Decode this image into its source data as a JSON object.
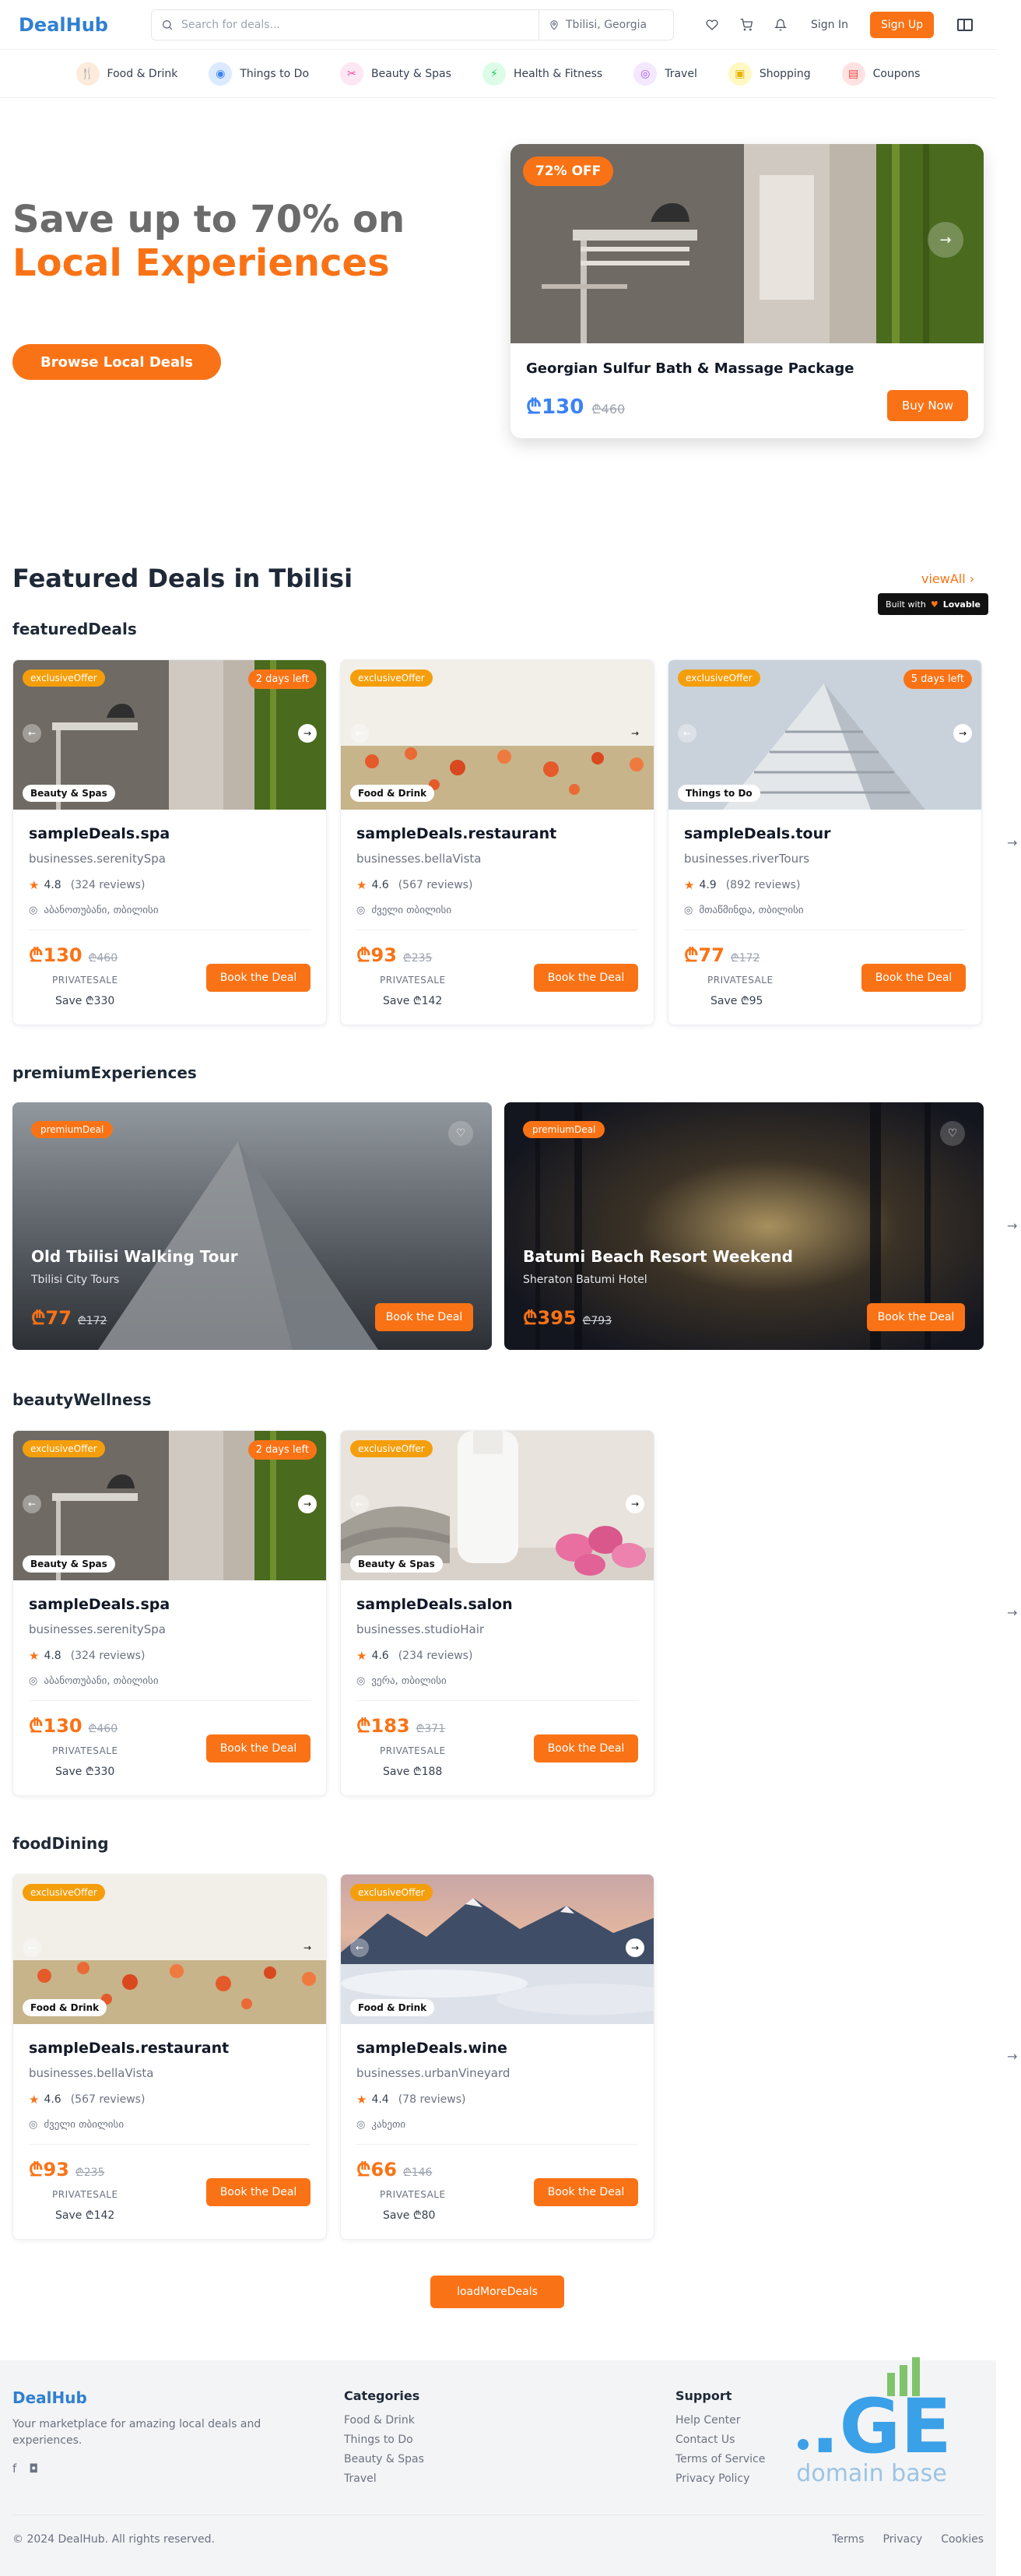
{
  "header": {
    "logo": "DealHub",
    "search_placeholder": "Search for deals...",
    "location": "Tbilisi, Georgia",
    "sign_in": "Sign In",
    "sign_up": "Sign Up"
  },
  "categories": [
    {
      "label": "Food & Drink",
      "icon": "utensils-icon",
      "color": "#f97316",
      "bg": "#fdecdc"
    },
    {
      "label": "Things to Do",
      "icon": "camera-icon",
      "color": "#3b82f6",
      "bg": "#dbeafe"
    },
    {
      "label": "Beauty & Spas",
      "icon": "scissors-icon",
      "color": "#ec4899",
      "bg": "#fce7f3"
    },
    {
      "label": "Health & Fitness",
      "icon": "activity-icon",
      "color": "#22c55e",
      "bg": "#dcfce7"
    },
    {
      "label": "Travel",
      "icon": "map-pin-icon",
      "color": "#a855f7",
      "bg": "#f3e8ff"
    },
    {
      "label": "Shopping",
      "icon": "shopping-bag-icon",
      "color": "#eab308",
      "bg": "#fef9c3"
    },
    {
      "label": "Coupons",
      "icon": "ticket-icon",
      "color": "#ef4444",
      "bg": "#fee2e2"
    }
  ],
  "hero": {
    "title_line1": "Save up to 70% on",
    "title_line2": "Local Experiences",
    "cta": "Browse Local Deals",
    "card": {
      "badge": "72% OFF",
      "name": "Georgian Sulfur Bath & Massage Package",
      "price": "₾130",
      "old_price": "₾460",
      "buy": "Buy Now"
    }
  },
  "featured": {
    "title": "Featured Deals in Tbilisi",
    "view_all": "viewAll",
    "built_with": "Built with",
    "built_brand": "Lovable"
  },
  "groups": {
    "featured": "featuredDeals",
    "premium": "premiumExperiences",
    "beauty": "beautyWellness",
    "food": "foodDining"
  },
  "cards": {
    "spa": {
      "chip": "exclusiveOffer",
      "days": "2 days left",
      "tag": "Beauty & Spas",
      "title": "sampleDeals.spa",
      "biz": "businesses.serenitySpa",
      "rating": "4.8",
      "reviews": "(324 reviews)",
      "addr": "აბანოთუბანი, თბილისი",
      "price": "₾130",
      "old": "₾460",
      "private": "PRIVATESALE",
      "save": "Save ₾330",
      "book": "Book the Deal"
    },
    "restaurant": {
      "chip": "exclusiveOffer",
      "tag": "Food & Drink",
      "title": "sampleDeals.restaurant",
      "biz": "businesses.bellaVista",
      "rating": "4.6",
      "reviews": "(567 reviews)",
      "addr": "ძველი თბილისი",
      "price": "₾93",
      "old": "₾235",
      "private": "PRIVATESALE",
      "save": "Save ₾142",
      "book": "Book the Deal"
    },
    "tour": {
      "chip": "exclusiveOffer",
      "days": "5 days left",
      "tag": "Things to Do",
      "title": "sampleDeals.tour",
      "biz": "businesses.riverTours",
      "rating": "4.9",
      "reviews": "(892 reviews)",
      "addr": "მთაწმინდა, თბილისი",
      "price": "₾77",
      "old": "₾172",
      "private": "PRIVATESALE",
      "save": "Save ₾95",
      "book": "Book the Deal"
    },
    "salon": {
      "chip": "exclusiveOffer",
      "tag": "Beauty & Spas",
      "title": "sampleDeals.salon",
      "biz": "businesses.studioHair",
      "rating": "4.6",
      "reviews": "(234 reviews)",
      "addr": "ვერა, თბილისი",
      "price": "₾183",
      "old": "₾371",
      "private": "PRIVATESALE",
      "save": "Save ₾188",
      "book": "Book the Deal"
    },
    "wine": {
      "chip": "exclusiveOffer",
      "tag": "Food & Drink",
      "title": "sampleDeals.wine",
      "biz": "businesses.urbanVineyard",
      "rating": "4.4",
      "reviews": "(78 reviews)",
      "addr": "კახეთი",
      "price": "₾66",
      "old": "₾146",
      "private": "PRIVATESALE",
      "save": "Save ₾80",
      "book": "Book the Deal"
    }
  },
  "premium": [
    {
      "chip": "premiumDeal",
      "title": "Old Tbilisi Walking Tour",
      "sub": "Tbilisi City Tours",
      "price": "₾77",
      "old": "₾172",
      "book": "Book the Deal"
    },
    {
      "chip": "premiumDeal",
      "title": "Batumi Beach Resort Weekend",
      "sub": "Sheraton Batumi Hotel",
      "price": "₾395",
      "old": "₾793",
      "book": "Book the Deal"
    }
  ],
  "load_more": "loadMoreDeals",
  "footer": {
    "logo": "DealHub",
    "desc": "Your marketplace for amazing local deals and experiences.",
    "categories_title": "Categories",
    "categories": [
      "Food & Drink",
      "Things to Do",
      "Beauty & Spas",
      "Travel"
    ],
    "support_title": "Support",
    "support": [
      "Help Center",
      "Contact Us",
      "Terms of Service",
      "Privacy Policy"
    ],
    "copyright": "© 2024 DealHub. All rights reserved.",
    "links": [
      "Terms",
      "Privacy",
      "Cookies"
    ],
    "ge_logo": ".GE",
    "ge_sub": "domain base"
  }
}
